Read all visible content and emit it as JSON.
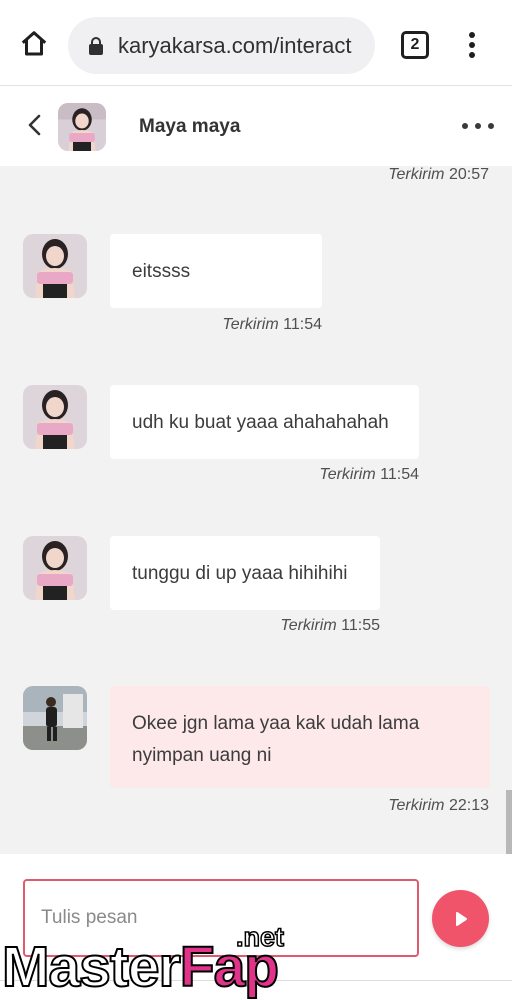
{
  "browser": {
    "url": "karyakarsa.com/interact",
    "tab_count": "2",
    "icons": {
      "home": "home-icon",
      "lock": "lock-icon",
      "menu": "more-vertical-icon"
    }
  },
  "chat": {
    "contact_name": "Maya maya",
    "icons": {
      "back": "chevron-left-icon",
      "more": "more-horizontal-icon"
    }
  },
  "messages": [
    {
      "sender": "them",
      "text": "",
      "status_label": "Terkirim",
      "time": "20:57"
    },
    {
      "sender": "them",
      "text": "eitssss",
      "status_label": "Terkirim",
      "time": "11:54"
    },
    {
      "sender": "them",
      "text": "udh ku buat yaaa ahahahahah",
      "status_label": "Terkirim",
      "time": "11:54"
    },
    {
      "sender": "them",
      "text": "tunggu di up yaaa hihihihi",
      "status_label": "Terkirim",
      "time": "11:55"
    },
    {
      "sender": "me",
      "text": "Okee jgn lama yaa kak udah lama nyimpan uang ni",
      "status_label": "Terkirim",
      "time": "22:13"
    }
  ],
  "composer": {
    "placeholder": "Tulis pesan",
    "send_icon": "send-icon"
  },
  "watermark": {
    "part1": "Master",
    "part2": "Fap",
    "suffix": ".net"
  },
  "colors": {
    "accent": "#f0546a",
    "input_border": "#e05a6e",
    "my_bubble": "#fde8ea",
    "their_bubble": "#ffffff",
    "background": "#f2f2f2"
  }
}
